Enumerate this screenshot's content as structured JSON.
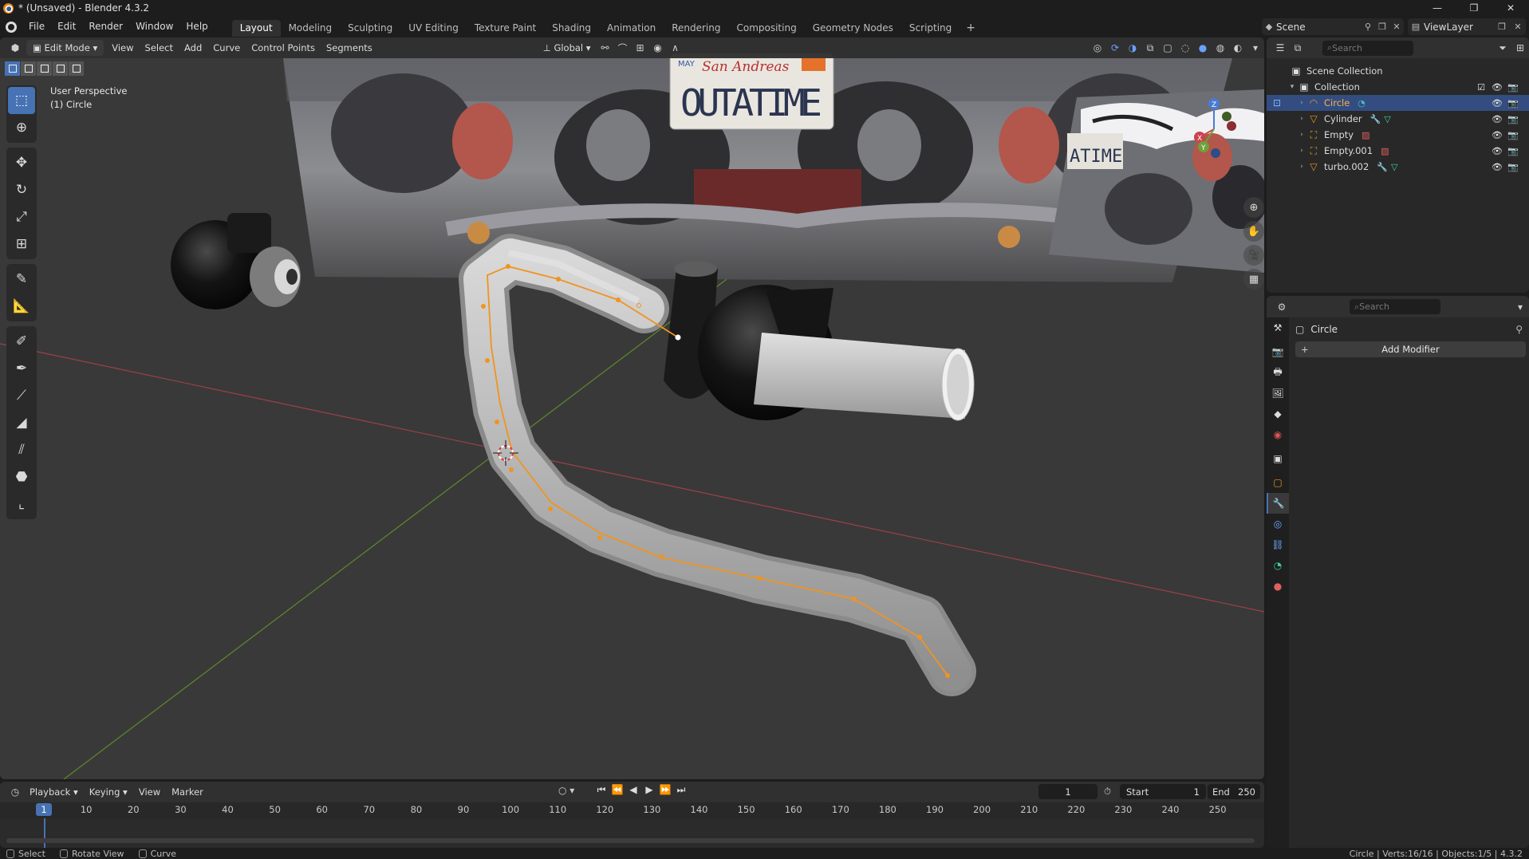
{
  "window": {
    "title": "* (Unsaved) - Blender 4.3.2",
    "min": "—",
    "max": "❐",
    "close": "✕"
  },
  "menu": [
    "File",
    "Edit",
    "Render",
    "Window",
    "Help"
  ],
  "workspaces": [
    "Layout",
    "Modeling",
    "Sculpting",
    "UV Editing",
    "Texture Paint",
    "Shading",
    "Animation",
    "Rendering",
    "Compositing",
    "Geometry Nodes",
    "Scripting"
  ],
  "workspace_add": "+",
  "scene": "Scene",
  "view_layer": "ViewLayer",
  "viewport": {
    "mode": "Edit Mode",
    "menus": [
      "View",
      "Select",
      "Add",
      "Curve",
      "Control Points",
      "Segments"
    ],
    "transform_orientation": "Global",
    "info_line1": "User Perspective",
    "info_line2": "(1) Circle",
    "plate_text": "OUTATIME",
    "plate_top": "San Andreas",
    "plate_tag": "MAY",
    "gizmo_axes": {
      "z": "Z",
      "y": "Y",
      "x": "X"
    }
  },
  "outliner": {
    "search_placeholder": "Search",
    "scene_collection": "Scene Collection",
    "collection": "Collection",
    "items": [
      {
        "name": "Circle",
        "type": "curve",
        "selected": true
      },
      {
        "name": "Cylinder",
        "type": "mesh",
        "selected": false
      },
      {
        "name": "Empty",
        "type": "empty",
        "selected": false
      },
      {
        "name": "Empty.001",
        "type": "empty",
        "selected": false
      },
      {
        "name": "turbo.002",
        "type": "mesh",
        "selected": false
      }
    ]
  },
  "properties": {
    "search_placeholder": "Search",
    "object_name": "Circle",
    "add_modifier": "Add Modifier"
  },
  "timeline": {
    "menus": [
      "Playback",
      "Keying",
      "View",
      "Marker"
    ],
    "current_frame": "1",
    "start_label": "Start",
    "start": "1",
    "end_label": "End",
    "end": "250",
    "ticks": [
      "10",
      "20",
      "30",
      "40",
      "50",
      "60",
      "70",
      "80",
      "90",
      "100",
      "110",
      "120",
      "130",
      "140",
      "150",
      "160",
      "170",
      "180",
      "190",
      "200",
      "210",
      "220",
      "230",
      "240",
      "250"
    ],
    "playhead": "1"
  },
  "statusbar": {
    "select": "Select",
    "rotate": "Rotate View",
    "curve": "Curve",
    "right": "Circle | Verts:16/16 | Objects:1/5 | 4.3.2"
  },
  "colors": {
    "accent": "#4772b3",
    "curve_orange": "#f0941f",
    "x_axis": "#b5474d",
    "y_axis": "#6e9a34",
    "bg_dark": "#1d1d1d",
    "viewport_bg": "#393939"
  }
}
